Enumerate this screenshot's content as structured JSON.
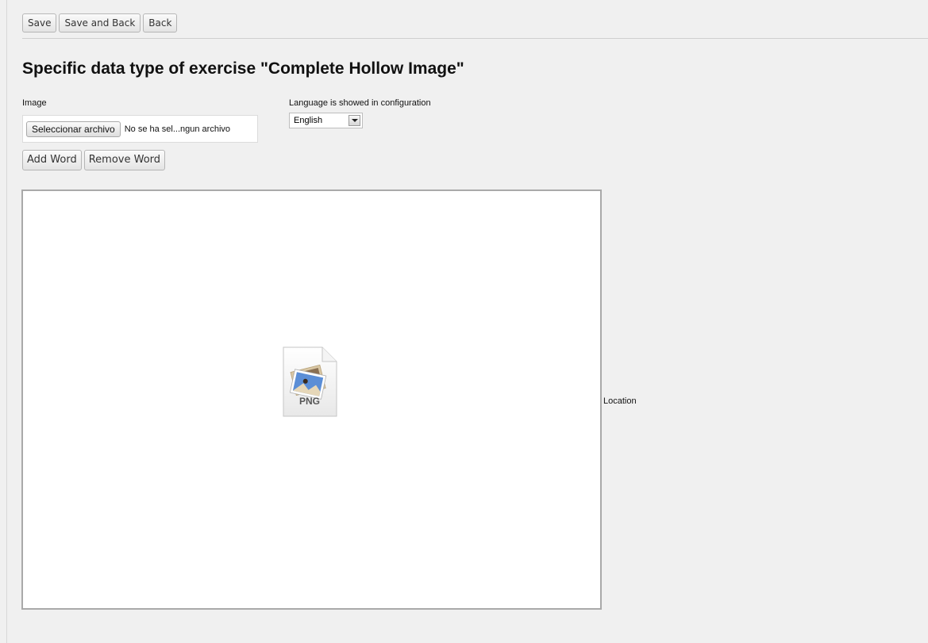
{
  "toolbar": {
    "save_label": "Save",
    "save_back_label": "Save and Back",
    "back_label": "Back"
  },
  "page_title": "Specific data type of exercise \"Complete Hollow Image\"",
  "image_field": {
    "label": "Image",
    "button_label": "Seleccionar archivo",
    "file_status": "No se ha sel...ngun archivo"
  },
  "language_field": {
    "label": "Language is showed in configuration",
    "selected": "English"
  },
  "word_buttons": {
    "add_label": "Add Word",
    "remove_label": "Remove Word"
  },
  "image_area": {
    "placeholder_icon": "png-file-icon",
    "placeholder_text": "PNG"
  },
  "location_label": "Location"
}
